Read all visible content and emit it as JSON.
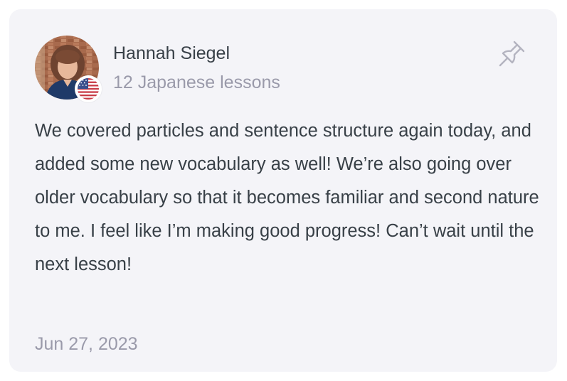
{
  "review": {
    "author_name": "Hannah Siegel",
    "lessons_count_text": "12 Japanese lessons",
    "country_flag_icon": "us-flag-icon",
    "pin_icon": "pin-icon",
    "body": "We covered particles and sentence structure again today, and added some new vocabulary as well! We’re also going over older vocabulary so that it becomes familiar and second nature to me. I feel like I’m making good progress! Can’t wait until the next lesson!",
    "date": "Jun 27, 2023"
  },
  "colors": {
    "card_background": "#f4f4f8",
    "text_primary": "#384047",
    "text_secondary": "#9a9aaa"
  }
}
